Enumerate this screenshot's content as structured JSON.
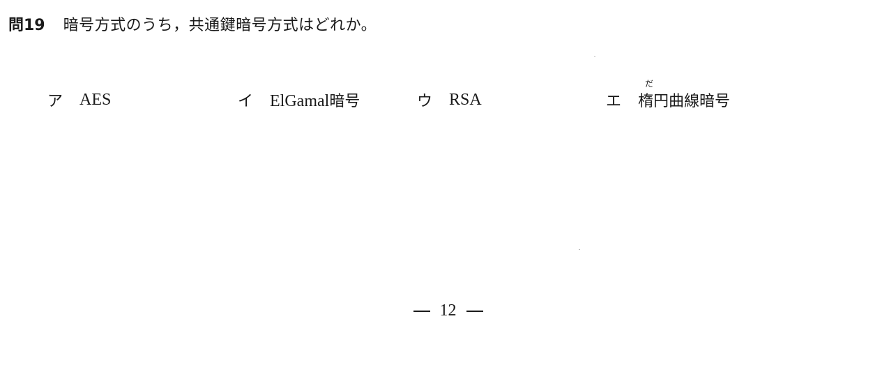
{
  "question": {
    "number": "問19",
    "text": "暗号方式のうち，共通鍵暗号方式はどれか。"
  },
  "options": [
    {
      "mark": "ア",
      "text": "AES"
    },
    {
      "mark": "イ",
      "text_latin": "ElGamal",
      "text_jp": "暗号"
    },
    {
      "mark": "ウ",
      "text": "RSA"
    },
    {
      "mark": "エ",
      "ruby": "だ",
      "first_char": "楕",
      "rest": "円曲線暗号"
    }
  ],
  "footer": {
    "page_number": "12"
  }
}
